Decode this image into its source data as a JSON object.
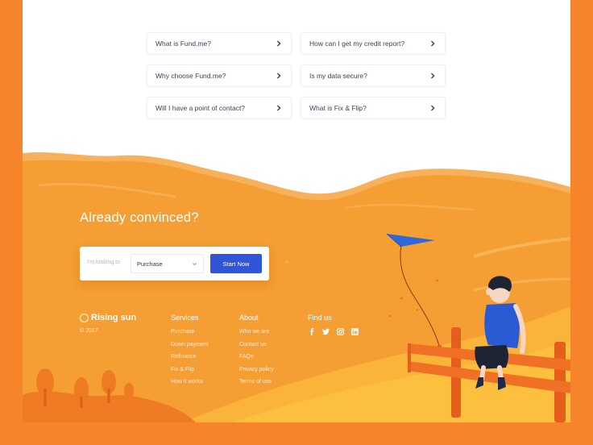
{
  "faq": [
    {
      "question": "What is Fund.me?"
    },
    {
      "question": "How can I get my credit report?"
    },
    {
      "question": "Why choose Fund.me?"
    },
    {
      "question": "Is my data secure?"
    },
    {
      "question": "Will I have a point of contact?"
    },
    {
      "question": "What is Fix & Flip?"
    }
  ],
  "hero": {
    "headline": "Already convinced?",
    "search": {
      "hint": "I'm looking to",
      "selected": "Purchase",
      "button": "Start Now"
    }
  },
  "footer": {
    "brand": "Rising sun",
    "copyright": "© 2017",
    "services": {
      "title": "Services",
      "links": [
        "Purchase",
        "Down payment",
        "Refinance",
        "Fix & Flip",
        "How it works"
      ]
    },
    "about": {
      "title": "About",
      "links": [
        "Who we are",
        "Contact us",
        "FAQs",
        "Privacy policy",
        "Terms of use"
      ]
    },
    "find_us": {
      "title": "Find us",
      "icons": [
        "facebook-icon",
        "twitter-icon",
        "instagram-icon",
        "linkedin-icon"
      ]
    }
  },
  "colors": {
    "page_bg": "#f5842a",
    "hill": "#f59e34",
    "accent_button": "#3155d6",
    "kite": "#2f68d9",
    "boy_shirt": "#2b5bd4",
    "fence": "#e65e1c"
  }
}
